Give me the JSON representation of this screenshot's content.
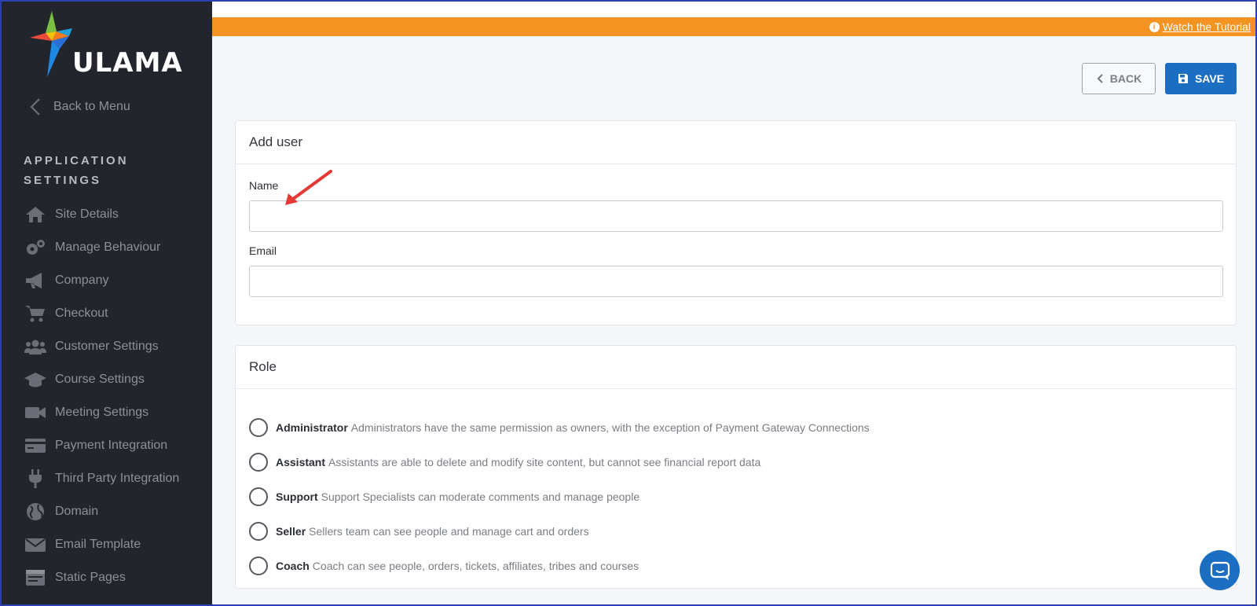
{
  "sidebar": {
    "logo_text": "ULAMA",
    "back_label": "Back to Menu",
    "section_title": "APPLICATION SETTINGS",
    "items": [
      {
        "label": "Site Details",
        "icon": "home-icon"
      },
      {
        "label": "Manage Behaviour",
        "icon": "gears-icon"
      },
      {
        "label": "Company",
        "icon": "megaphone-icon"
      },
      {
        "label": "Checkout",
        "icon": "cart-icon"
      },
      {
        "label": "Customer Settings",
        "icon": "users-icon"
      },
      {
        "label": "Course Settings",
        "icon": "graduation-cap-icon"
      },
      {
        "label": "Meeting Settings",
        "icon": "video-camera-icon"
      },
      {
        "label": "Payment Integration",
        "icon": "credit-card-icon"
      },
      {
        "label": "Third Party Integration",
        "icon": "plug-icon"
      },
      {
        "label": "Domain",
        "icon": "globe-icon"
      },
      {
        "label": "Email Template",
        "icon": "envelope-icon"
      },
      {
        "label": "Static Pages",
        "icon": "page-icon"
      }
    ]
  },
  "banner": {
    "tutorial_label": "Watch the Tutorial",
    "info_symbol": "i"
  },
  "toolbar": {
    "back_label": "BACK",
    "save_label": "SAVE"
  },
  "add_user": {
    "title": "Add user",
    "name_label": "Name",
    "name_value": "",
    "email_label": "Email",
    "email_value": ""
  },
  "role": {
    "title": "Role",
    "options": [
      {
        "name": "Administrator",
        "description": "Administrators have the same permission as owners, with the exception of Payment Gateway Connections",
        "selected": false
      },
      {
        "name": "Assistant",
        "description": "Assistants are able to delete and modify site content, but cannot see financial report data",
        "selected": false
      },
      {
        "name": "Support",
        "description": "Support Specialists can moderate comments and manage people",
        "selected": false
      },
      {
        "name": "Seller",
        "description": "Sellers team can see people and manage cart and orders",
        "selected": false
      },
      {
        "name": "Coach",
        "description": "Coach can see people, orders, tickets, affiliates, tribes and courses",
        "selected": false
      }
    ]
  },
  "colors": {
    "sidebar_bg": "#23252d",
    "banner": "#f39422",
    "primary": "#1b6ec2",
    "annotation_arrow": "#e53935"
  }
}
